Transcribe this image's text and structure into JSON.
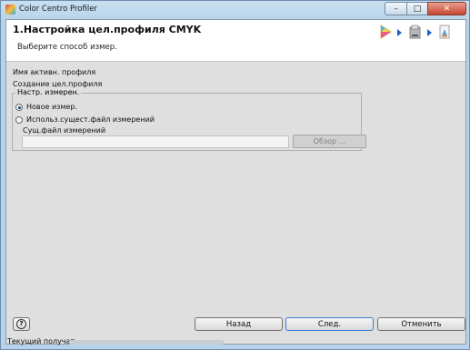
{
  "window": {
    "title": "Color Centro Profiler",
    "controls": {
      "minimize": "–",
      "maximize": "□",
      "close": "✕"
    }
  },
  "header": {
    "title": "1.Настройка цел.профиля CMYK",
    "subtitle": "Выберите способ измер.",
    "steps": [
      "target-step-icon",
      "printer-step-icon",
      "profile-step-icon"
    ]
  },
  "profile": {
    "active_label": "Имя активн. профиля",
    "create_label": "Создание цел.профиля"
  },
  "measurement": {
    "group_title": "Настр. измерен.",
    "options": [
      {
        "label": "Новое измер.",
        "selected": true
      },
      {
        "label": "Использ.сущест.файл измерений",
        "selected": false
      }
    ],
    "file_label": "Сущ.файл измерений",
    "file_value": "",
    "browse_label": "Обзор ..."
  },
  "footer": {
    "help_label": "?",
    "back_label": "Назад",
    "next_label": "След.",
    "cancel_label": "Отменить"
  },
  "status": {
    "label": "Текущий получат.:"
  },
  "colors": {
    "window_frame": "#b8d3e9",
    "client_bg": "#dfdfdf",
    "header_bg": "#ffffff",
    "close_red": "#c7442f",
    "step_arrow": "#1f5fcf"
  }
}
